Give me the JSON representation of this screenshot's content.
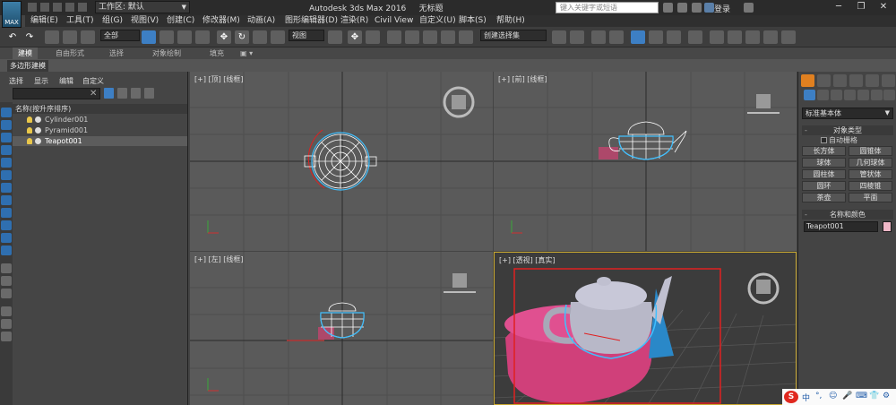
{
  "titlebar": {
    "logo_text": "MAX",
    "workspace_label": "工作区: 默认",
    "app_title": "Autodesk 3ds Max 2016",
    "doc_title": "无标题",
    "search_placeholder": "键入关键字或短语",
    "login": "登录"
  },
  "menu": [
    "编辑(E)",
    "工具(T)",
    "组(G)",
    "视图(V)",
    "创建(C)",
    "修改器(M)",
    "动画(A)",
    "图形编辑器(D)",
    "渲染(R)",
    "Civil View",
    "自定义(U)",
    "脚本(S)",
    "帮助(H)"
  ],
  "toolbar": {
    "filter_value": "全部",
    "coord_value": "视图",
    "selection_set": "创建选择集"
  },
  "ribbon": {
    "tabs": [
      "建模",
      "自由形式",
      "选择",
      "对象绘制",
      "填充"
    ],
    "sub_label": "多边形建模"
  },
  "explorer": {
    "menu": [
      "选择",
      "显示",
      "编辑",
      "自定义"
    ],
    "header": "名称(按升序排序)",
    "objects": [
      {
        "name": "Cylinder001"
      },
      {
        "name": "Pyramid001"
      },
      {
        "name": "Teapot001"
      }
    ]
  },
  "viewports": {
    "top": "[+] [顶] [线框]",
    "front": "[+] [前] [线框]",
    "left": "[+] [左] [线框]",
    "persp": "[+] [透视] [真实]"
  },
  "cmdpanel": {
    "category": "标准基本体",
    "rollout_object_type": "对象类型",
    "autogrid": "自动栅格",
    "buttons": [
      "长方体",
      "圆锥体",
      "球体",
      "几何球体",
      "圆柱体",
      "管状体",
      "圆环",
      "四棱锥",
      "茶壶",
      "平面"
    ],
    "rollout_name_color": "名称和颜色",
    "object_name": "Teapot001"
  },
  "ime": {
    "logo": "S",
    "items": [
      "中",
      "°,",
      "☺",
      "🎤",
      "⌨",
      "👕",
      "⚙"
    ]
  },
  "colors": {
    "accent": "#3d7fc4",
    "selection_box": "#e02020",
    "teapot_wire": "#ffffff",
    "cylinder": "#e0508a",
    "pyramid": "#2a8fd0"
  }
}
